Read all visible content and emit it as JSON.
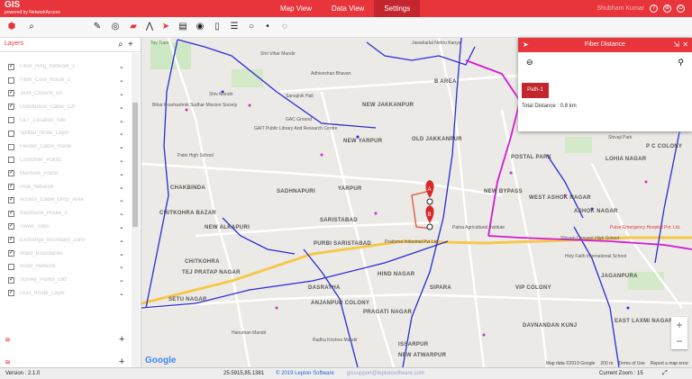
{
  "app": {
    "logo": "GIS",
    "logo_sub": "powered by NetworkAccess"
  },
  "nav": {
    "tabs": [
      "Map View",
      "Data View",
      "Settings"
    ],
    "active": "Settings"
  },
  "user": {
    "name": "Shubham Kumar"
  },
  "colors": {
    "brand": "#e8353b",
    "route_blue": "#2b2bd6",
    "fiber_magenta": "#d21bd2",
    "path_red": "#e5533a",
    "road_yellow": "#f5c84a"
  },
  "toolbar_icons": [
    "home-icon",
    "search-icon",
    "pin-tool-icon",
    "route-icon",
    "truck-icon",
    "road-icon",
    "navigate-icon",
    "table-icon",
    "target-icon",
    "ruler-icon",
    "list-icon",
    "circle-icon",
    "point-icon"
  ],
  "panel": {
    "title": "Layers",
    "layers": [
      {
        "name": "Fiber_Ring_Network_1",
        "checked": true
      },
      {
        "name": "Fiber_Core_Route_2",
        "checked": false
      },
      {
        "name": "Joint_Closure_BX",
        "checked": true
      },
      {
        "name": "Distribution_Cable_12F",
        "checked": true
      },
      {
        "name": "OLT_Location_Site",
        "checked": false
      },
      {
        "name": "Splitter_Node_Layer",
        "checked": false
      },
      {
        "name": "Feeder_Cable_Route",
        "checked": false
      },
      {
        "name": "Customer_Points",
        "checked": false
      },
      {
        "name": "Manhole_Points",
        "checked": true
      },
      {
        "name": "Pole_Network",
        "checked": true
      },
      {
        "name": "Access_Cable_Drop_Area",
        "checked": true
      },
      {
        "name": "Backbone_Route_3",
        "checked": true
      },
      {
        "name": "Tower_Sites",
        "checked": true
      },
      {
        "name": "Exchange_Boundary_Zone",
        "checked": true
      },
      {
        "name": "Ward_Boundaries",
        "checked": true
      },
      {
        "name": "Road_Network",
        "checked": false
      },
      {
        "name": "Survey_Points_Old",
        "checked": true
      },
      {
        "name": "Duct_Route_Layer",
        "checked": true
      }
    ],
    "sections": [
      {
        "icon": "stack-icon"
      },
      {
        "icon": "stack-icon"
      }
    ]
  },
  "map": {
    "labels": [
      {
        "t": "Toy Train",
        "c": "#3a8a3a"
      },
      {
        "t": "Jawaharlal Nehru Kanya",
        "c": "#555"
      },
      {
        "t": "Shri Vihar Mandir",
        "c": "#555"
      },
      {
        "t": "Adhiveshan Bhavan",
        "c": "#555"
      },
      {
        "t": "Shiv Mandir",
        "c": "#555"
      },
      {
        "t": "Bihar Prashashnik Sudhar Mission Society",
        "c": "#555"
      },
      {
        "t": "Sarvajnik Hall",
        "c": "#555"
      },
      {
        "t": "GAC Ground",
        "c": "#555"
      },
      {
        "t": "GAIT Public Library And Research Centre",
        "c": "#555"
      },
      {
        "t": "B AREA",
        "c": "#555"
      },
      {
        "t": "NEW JAKKANPUR",
        "c": "#555"
      },
      {
        "t": "OLD JAKKANPUR",
        "c": "#555"
      },
      {
        "t": "Patio High School",
        "c": "#555"
      },
      {
        "t": "NEW YARPUR",
        "c": "#555"
      },
      {
        "t": "POSTAL PARK",
        "c": "#555"
      },
      {
        "t": "Shivaji Park",
        "c": "#555"
      },
      {
        "t": "P C COLONY",
        "c": "#555"
      },
      {
        "t": "LOHIA NAGAR",
        "c": "#555"
      },
      {
        "t": "CHAKBINDA",
        "c": "#555"
      },
      {
        "t": "SADHNAPURI",
        "c": "#555"
      },
      {
        "t": "YARPUR",
        "c": "#555"
      },
      {
        "t": "NEW BYPASS",
        "c": "#555"
      },
      {
        "t": "WEST ASHOK NAGAR",
        "c": "#555"
      },
      {
        "t": "ASHOK NAGAR",
        "c": "#555"
      },
      {
        "t": "CHITKOHRA BAZAR",
        "c": "#555"
      },
      {
        "t": "NEW ALKAPURI",
        "c": "#555"
      },
      {
        "t": "SARISTABAD",
        "c": "#555"
      },
      {
        "t": "PURBI SARISTABAD",
        "c": "#555"
      },
      {
        "t": "Patna Agricultural Institute",
        "c": "#555"
      },
      {
        "t": "Shivam Convent High School",
        "c": "#555"
      },
      {
        "t": "Pulse Emergency Hospital Pvt. Ltd.",
        "c": "#e8353b"
      },
      {
        "t": "Prathima Industrial Pvt Ltd",
        "c": "#555"
      },
      {
        "t": "Holy Faith International School",
        "c": "#555"
      },
      {
        "t": "CHITKOHRA",
        "c": "#555"
      },
      {
        "t": "TEJ PRATAP NAGAR",
        "c": "#555"
      },
      {
        "t": "HIND NAGAR",
        "c": "#555"
      },
      {
        "t": "JAGANPURA",
        "c": "#555"
      },
      {
        "t": "DASRATHA",
        "c": "#555"
      },
      {
        "t": "SIPARA",
        "c": "#555"
      },
      {
        "t": "VIP COLONY",
        "c": "#555"
      },
      {
        "t": "SETU NAGAR",
        "c": "#555"
      },
      {
        "t": "ANJANPUR COLONY",
        "c": "#555"
      },
      {
        "t": "PRAGATI NAGAR",
        "c": "#555"
      },
      {
        "t": "DAVNANDAN KUNJ",
        "c": "#555"
      },
      {
        "t": "EAST LAXMI NAGAR",
        "c": "#555"
      },
      {
        "t": "Hanuman Mandir",
        "c": "#555"
      },
      {
        "t": "Radha Krishna Mandir",
        "c": "#555"
      },
      {
        "t": "ISSARPUR",
        "c": "#555"
      },
      {
        "t": "NEW ATWARPUR",
        "c": "#555"
      }
    ],
    "markers": [
      {
        "label": "A"
      },
      {
        "label": "B"
      }
    ],
    "google": "Google",
    "footer": [
      "Map data ©2019 Google",
      "200 m",
      "Terms of Use",
      "Report a map error"
    ],
    "zoom_in": "+",
    "zoom_out": "−"
  },
  "distance_panel": {
    "title": "Fiber Distance",
    "paths": [
      "Path-1"
    ],
    "total_label": "Total Distance : 0.8 km"
  },
  "status": {
    "version": "Version : 2.1.0",
    "coords": "25.5915,85.1381",
    "copyright": "© 2019 Lepton Software",
    "email": "gissupport@leptonsoftware.com",
    "zoom": "Current Zoom : 15"
  }
}
